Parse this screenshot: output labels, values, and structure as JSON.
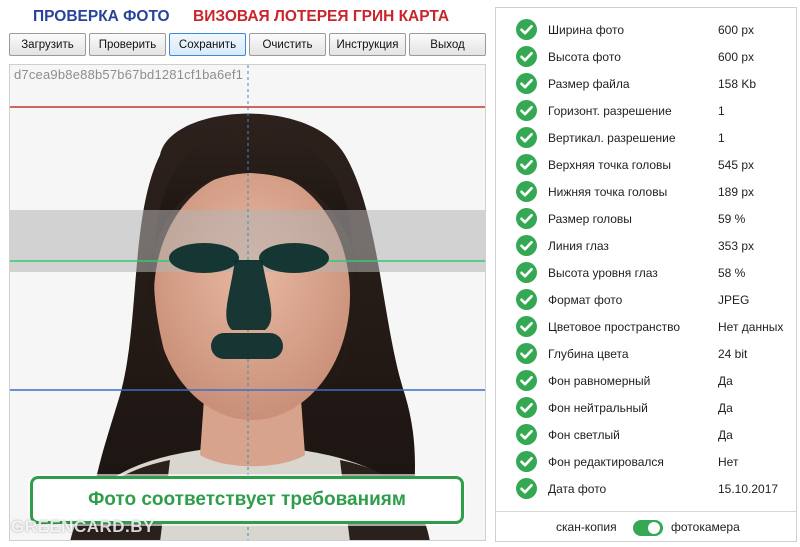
{
  "header": {
    "title_left": "ПРОВЕРКА ФОТО",
    "title_right": "ВИЗОВАЯ ЛОТЕРЕЯ ГРИН КАРТА",
    "title_left_color": "#27449a",
    "title_right_color": "#c9252b"
  },
  "toolbar": {
    "buttons": [
      {
        "label": "Загрузить"
      },
      {
        "label": "Проверить"
      },
      {
        "label": "Сохранить",
        "active": true
      },
      {
        "label": "Очистить"
      },
      {
        "label": "Инструкция"
      },
      {
        "label": "Выход"
      }
    ]
  },
  "photo": {
    "hash": "d7cea9b8e88b57b67bd1281cf1ba6ef1",
    "status_message": "Фото соответствует требованиям",
    "watermark": "GREENCARD.BY",
    "status_color": "#2f9e4b"
  },
  "checks": [
    {
      "label": "Ширина фото",
      "value": "600 px"
    },
    {
      "label": "Высота фото",
      "value": "600 px"
    },
    {
      "label": "Размер файла",
      "value": "158 Kb"
    },
    {
      "label": "Горизонт. разрешение",
      "value": "1"
    },
    {
      "label": "Вертикал. разрешение",
      "value": "1"
    },
    {
      "label": "Верхняя точка головы",
      "value": "545 px"
    },
    {
      "label": "Нижняя точка головы",
      "value": "189 px"
    },
    {
      "label": "Размер головы",
      "value": "59 %"
    },
    {
      "label": "Линия глаз",
      "value": "353 px"
    },
    {
      "label": "Высота уровня глаз",
      "value": "58 %"
    },
    {
      "label": "Формат фото",
      "value": "JPEG"
    },
    {
      "label": "Цветовое пространство",
      "value": "Нет данных"
    },
    {
      "label": "Глубина цвета",
      "value": "24 bit"
    },
    {
      "label": "Фон равномерный",
      "value": "Да"
    },
    {
      "label": "Фон нейтральный",
      "value": "Да"
    },
    {
      "label": "Фон светлый",
      "value": "Да"
    },
    {
      "label": "Фон редактировался",
      "value": "Нет"
    },
    {
      "label": "Дата фото",
      "value": "15.10.2017"
    }
  ],
  "source_switch": {
    "left_label": "скан-копия",
    "right_label": "фотокамера",
    "on": true
  },
  "colors": {
    "check_green": "#34a853",
    "guide_red": "#c0392b",
    "guide_green": "#2ecc71",
    "guide_blue": "#3b6fc4"
  }
}
